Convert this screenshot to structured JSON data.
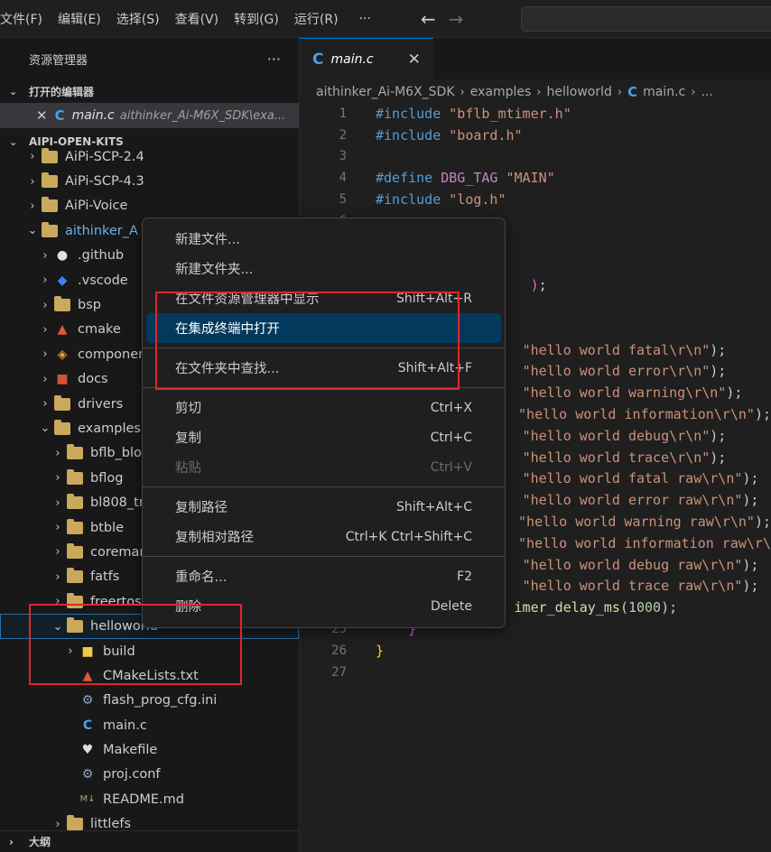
{
  "menubar": {
    "items": [
      "文件(F)",
      "编辑(E)",
      "选择(S)",
      "查看(V)",
      "转到(G)",
      "运行(R)"
    ],
    "more": "···",
    "back_icon": "arrow-left-icon",
    "forward_icon": "arrow-right-icon"
  },
  "sidebar": {
    "title": "资源管理器",
    "more": "···",
    "open_editors_label": "打开的编辑器",
    "open_editor": {
      "name": "main.c",
      "path": "aithinker_Ai-M6X_SDK\\exa..."
    },
    "workspace_label": "AIPI-OPEN-KITS",
    "tree": [
      {
        "label": "AiPi-SCP-2.4",
        "chev": "›",
        "icon": "folder",
        "indent": 0
      },
      {
        "label": "AiPi-SCP-4.3",
        "chev": "›",
        "icon": "folder",
        "indent": 0
      },
      {
        "label": "AiPi-Voice",
        "chev": "›",
        "icon": "folder",
        "indent": 0
      },
      {
        "label": "aithinker_A",
        "chev": "⌄",
        "icon": "folder-open",
        "indent": 0,
        "accent": true
      },
      {
        "label": ".github",
        "chev": "›",
        "icon": "github",
        "indent": 1
      },
      {
        "label": ".vscode",
        "chev": "›",
        "icon": "vscode",
        "indent": 1
      },
      {
        "label": "bsp",
        "chev": "›",
        "icon": "folder",
        "indent": 1
      },
      {
        "label": "cmake",
        "chev": "›",
        "icon": "cmake",
        "indent": 1
      },
      {
        "label": "componen",
        "chev": "›",
        "icon": "components",
        "indent": 1
      },
      {
        "label": "docs",
        "chev": "›",
        "icon": "docs",
        "indent": 1
      },
      {
        "label": "drivers",
        "chev": "›",
        "icon": "folder",
        "indent": 1
      },
      {
        "label": "examples",
        "chev": "⌄",
        "icon": "folder-open",
        "indent": 1
      },
      {
        "label": "bflb_bloc",
        "chev": "›",
        "icon": "folder",
        "indent": 2
      },
      {
        "label": "bflog",
        "chev": "›",
        "icon": "folder",
        "indent": 2
      },
      {
        "label": "bl808_tri",
        "chev": "›",
        "icon": "folder",
        "indent": 2
      },
      {
        "label": "btble",
        "chev": "›",
        "icon": "folder",
        "indent": 2
      },
      {
        "label": "coremar",
        "chev": "›",
        "icon": "folder",
        "indent": 2
      },
      {
        "label": "fatfs",
        "chev": "›",
        "icon": "folder",
        "indent": 2
      },
      {
        "label": "freertos",
        "chev": "›",
        "icon": "folder",
        "indent": 2
      },
      {
        "label": "helloworld",
        "chev": "⌄",
        "icon": "folder-open",
        "indent": 2,
        "selected": true
      },
      {
        "label": "build",
        "chev": "›",
        "icon": "build",
        "indent": 3
      },
      {
        "label": "CMakeLists.txt",
        "chev": "",
        "icon": "cmake",
        "indent": 3
      },
      {
        "label": "flash_prog_cfg.ini",
        "chev": "",
        "icon": "gear",
        "indent": 3
      },
      {
        "label": "main.c",
        "chev": "",
        "icon": "c",
        "indent": 3
      },
      {
        "label": "Makefile",
        "chev": "",
        "icon": "makefile",
        "indent": 3
      },
      {
        "label": "proj.conf",
        "chev": "",
        "icon": "gear",
        "indent": 3
      },
      {
        "label": "README.md",
        "chev": "",
        "icon": "markdown",
        "indent": 3
      },
      {
        "label": "littlefs",
        "chev": "›",
        "icon": "folder",
        "indent": 2
      }
    ],
    "outline_label": "大纲"
  },
  "editor": {
    "tab": {
      "name": "main.c"
    },
    "breadcrumb": [
      "aithinker_Ai-M6X_SDK",
      "examples",
      "helloworld",
      "main.c",
      "..."
    ],
    "lines": [
      {
        "n": "1",
        "segs": [
          [
            "pp",
            "#include "
          ],
          [
            "str",
            "\"bflb_mtimer.h\""
          ]
        ]
      },
      {
        "n": "2",
        "segs": [
          [
            "pp",
            "#include "
          ],
          [
            "str",
            "\"board.h\""
          ]
        ]
      },
      {
        "n": "3",
        "segs": []
      },
      {
        "n": "4",
        "segs": [
          [
            "pp",
            "#define "
          ],
          [
            "mac",
            "DBG_TAG "
          ],
          [
            "str",
            "\"MAIN\""
          ]
        ]
      },
      {
        "n": "5",
        "segs": [
          [
            "pp",
            "#include "
          ],
          [
            "str",
            "\"log.h\""
          ]
        ]
      },
      {
        "n": "6",
        "segs": []
      },
      {
        "n": "7",
        "segs": []
      },
      {
        "n": "8",
        "segs": []
      },
      {
        "n": "9",
        "segs": [
          [
            "plain",
            "                   "
          ],
          [
            "brace2",
            ")"
          ],
          [
            "plain",
            ";"
          ]
        ]
      },
      {
        "n": "10",
        "segs": []
      },
      {
        "n": "11",
        "segs": []
      },
      {
        "n": "12",
        "segs": [
          [
            "plain",
            "                  "
          ],
          [
            "str",
            "\"hello world fatal\\r\\n\""
          ],
          [
            "plain",
            ");"
          ]
        ]
      },
      {
        "n": "13",
        "segs": [
          [
            "plain",
            "                  "
          ],
          [
            "str",
            "\"hello world error\\r\\n\""
          ],
          [
            "plain",
            ");"
          ]
        ]
      },
      {
        "n": "14",
        "segs": [
          [
            "plain",
            "                  "
          ],
          [
            "str",
            "\"hello world warning\\r\\n\""
          ],
          [
            "plain",
            ");"
          ]
        ]
      },
      {
        "n": "15",
        "segs": [
          [
            "plain",
            "                  "
          ],
          [
            "str",
            "\"hello world information\\r\\n\""
          ],
          [
            "plain",
            ");"
          ]
        ]
      },
      {
        "n": "16",
        "segs": [
          [
            "plain",
            "                  "
          ],
          [
            "str",
            "\"hello world debug\\r\\n\""
          ],
          [
            "plain",
            ");"
          ]
        ]
      },
      {
        "n": "17",
        "segs": [
          [
            "plain",
            "                  "
          ],
          [
            "str",
            "\"hello world trace\\r\\n\""
          ],
          [
            "plain",
            ");"
          ]
        ]
      },
      {
        "n": "18",
        "segs": [
          [
            "plain",
            "                  "
          ],
          [
            "str",
            "\"hello world fatal raw\\r\\n\""
          ],
          [
            "plain",
            ");"
          ]
        ]
      },
      {
        "n": "19",
        "segs": [
          [
            "plain",
            "                  "
          ],
          [
            "str",
            "\"hello world error raw\\r\\n\""
          ],
          [
            "plain",
            ");"
          ]
        ]
      },
      {
        "n": "20",
        "segs": [
          [
            "plain",
            "                  "
          ],
          [
            "str",
            "\"hello world warning raw\\r\\n\""
          ],
          [
            "plain",
            ");"
          ]
        ]
      },
      {
        "n": "21",
        "segs": [
          [
            "plain",
            "                  "
          ],
          [
            "str",
            "\"hello world information raw\\r\\"
          ]
        ]
      },
      {
        "n": "22",
        "segs": [
          [
            "plain",
            "                  "
          ],
          [
            "str",
            "\"hello world debug raw\\r\\n\""
          ],
          [
            "plain",
            ");"
          ]
        ]
      },
      {
        "n": "23",
        "segs": [
          [
            "plain",
            "                  "
          ],
          [
            "str",
            "\"hello world trace raw\\r\\n\""
          ],
          [
            "plain",
            ");"
          ]
        ]
      },
      {
        "n": "24",
        "segs": [
          [
            "plain",
            "                 "
          ],
          [
            "fn",
            "imer_delay_ms"
          ],
          [
            "plain",
            "("
          ],
          [
            "num",
            "1000"
          ],
          [
            "plain",
            ");"
          ]
        ]
      },
      {
        "n": "25",
        "segs": [
          [
            "plain",
            "    "
          ],
          [
            "brace2",
            "}"
          ]
        ]
      },
      {
        "n": "26",
        "segs": [
          [
            "brace",
            "}"
          ]
        ]
      },
      {
        "n": "27",
        "segs": []
      }
    ]
  },
  "context_menu": {
    "groups": [
      [
        {
          "label": "新建文件...",
          "key": ""
        },
        {
          "label": "新建文件夹...",
          "key": ""
        },
        {
          "label": "在文件资源管理器中显示",
          "key": "Shift+Alt+R"
        },
        {
          "label": "在集成终端中打开",
          "key": "",
          "highlight": true
        }
      ],
      [
        {
          "label": "在文件夹中查找...",
          "key": "Shift+Alt+F"
        }
      ],
      [
        {
          "label": "剪切",
          "key": "Ctrl+X"
        },
        {
          "label": "复制",
          "key": "Ctrl+C"
        },
        {
          "label": "粘贴",
          "key": "Ctrl+V",
          "disabled": true
        }
      ],
      [
        {
          "label": "复制路径",
          "key": "Shift+Alt+C"
        },
        {
          "label": "复制相对路径",
          "key": "Ctrl+K Ctrl+Shift+C"
        }
      ],
      [
        {
          "label": "重命名...",
          "key": "F2"
        },
        {
          "label": "删除",
          "key": "Delete"
        }
      ]
    ]
  },
  "colors": {
    "accent": "#0078d4",
    "annotation": "#e0262b",
    "menu_highlight": "#04395e"
  }
}
